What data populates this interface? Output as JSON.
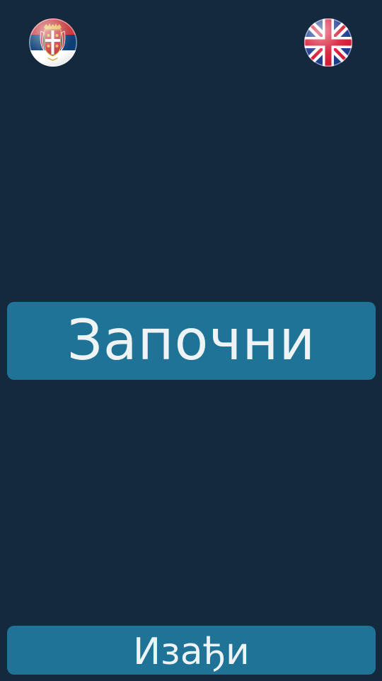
{
  "language_selector": {
    "serbian_flag_icon": "serbia-flag-icon",
    "english_flag_icon": "uk-flag-icon"
  },
  "main_menu": {
    "start_label": "Започни",
    "exit_label": "Изађи"
  },
  "colors": {
    "background": "#15293e",
    "button": "#1f7396",
    "button_text": "#eef3f6"
  }
}
